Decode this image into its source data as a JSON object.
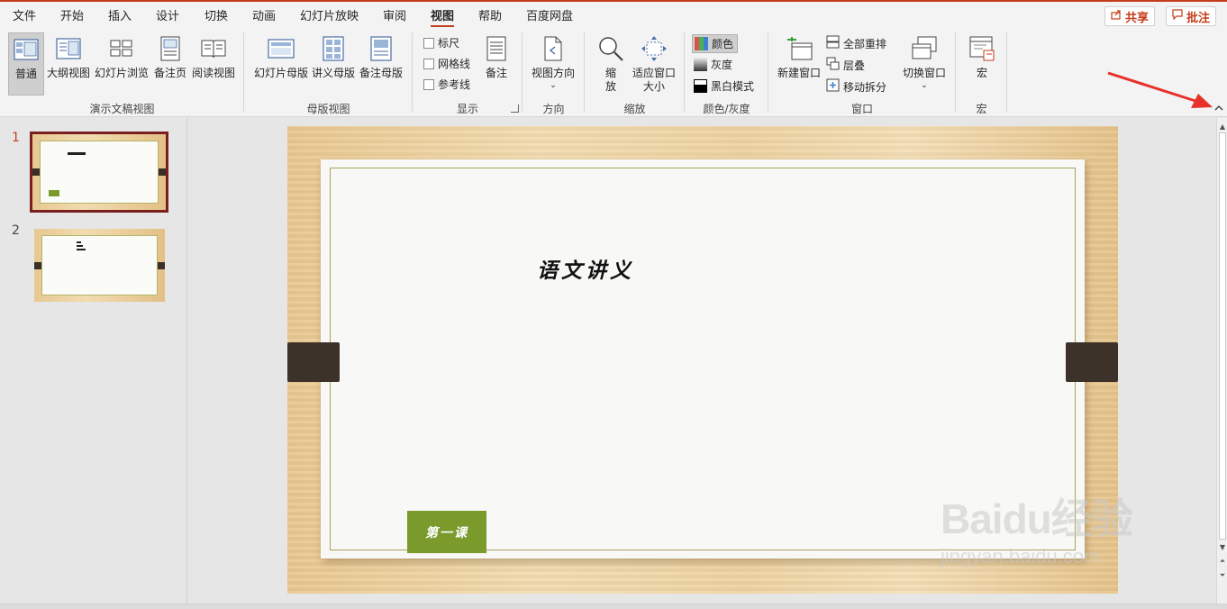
{
  "menu": {
    "tabs": [
      "文件",
      "开始",
      "插入",
      "设计",
      "切换",
      "动画",
      "幻灯片放映",
      "审阅",
      "视图",
      "帮助",
      "百度网盘"
    ],
    "active_tab": "视图",
    "share_label": "共享",
    "comment_label": "批注"
  },
  "ribbon": {
    "presentation_views": {
      "label": "演示文稿视图",
      "buttons": [
        "普通",
        "大纲视图",
        "幻灯片浏览",
        "备注页",
        "阅读视图"
      ]
    },
    "master_views": {
      "label": "母版视图",
      "buttons": [
        "幻灯片母版",
        "讲义母版",
        "备注母版"
      ]
    },
    "show": {
      "label": "显示",
      "checkboxes": [
        "标尺",
        "网格线",
        "参考线"
      ],
      "notes_button": "备注"
    },
    "orientation": {
      "label": "方向",
      "button": "视图方向"
    },
    "zoom": {
      "label": "缩放",
      "zoom_button": "缩放",
      "fit_button": "适应窗口大小"
    },
    "color": {
      "label": "颜色/灰度",
      "options": [
        "颜色",
        "灰度",
        "黑白模式"
      ]
    },
    "window": {
      "label": "窗口",
      "new_window": "新建窗口",
      "arrange_all": "全部重排",
      "cascade": "层叠",
      "move_split": "移动拆分",
      "switch_window": "切换窗口"
    },
    "macros": {
      "label": "宏",
      "button": "宏"
    }
  },
  "thumbnails": [
    {
      "number": "1",
      "selected": true
    },
    {
      "number": "2",
      "selected": false
    }
  ],
  "slide": {
    "title": "语文讲义",
    "button_text": "第一课"
  },
  "watermark": {
    "logo": "Baidu经验",
    "url": "jingyan.baidu.com"
  },
  "colors": {
    "accent": "#c43e1c",
    "annotation_arrow": "#e8302b",
    "lesson_button": "#7b9a2c",
    "selected_thumb_border": "#7a1f1f"
  }
}
